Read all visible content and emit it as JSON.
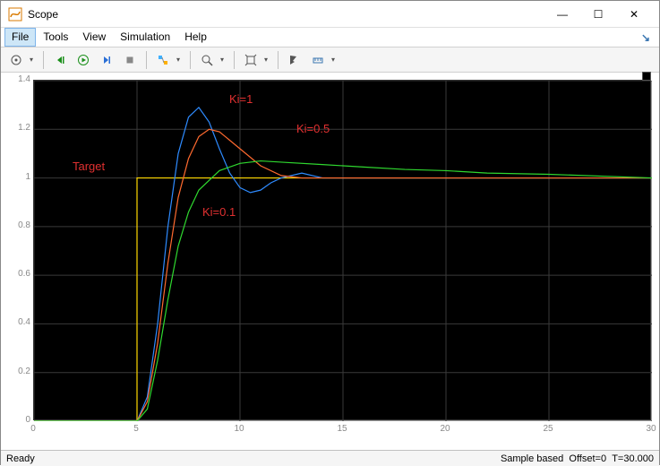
{
  "window": {
    "title": "Scope",
    "min": "—",
    "max": "☐",
    "close": "✕"
  },
  "menu": {
    "file": "File",
    "tools": "Tools",
    "view": "View",
    "simulation": "Simulation",
    "help": "Help",
    "corner": "↘"
  },
  "toolbar_icons": {
    "gear": "gear",
    "back": "step-back",
    "run": "run",
    "forward": "step-forward",
    "stop": "stop",
    "highlight": "highlight",
    "zoom": "zoom",
    "scale": "scale",
    "cursor": "cursor",
    "measure": "measure"
  },
  "annotations": {
    "target": "Target",
    "ki1": "Ki=1",
    "ki05": "Ki=0.5",
    "ki01": "Ki=0.1"
  },
  "status": {
    "ready": "Ready",
    "sample": "Sample based",
    "offset": "Offset=0",
    "time": "T=30.000"
  },
  "chart_data": {
    "type": "line",
    "xlabel": "",
    "ylabel": "",
    "xlim": [
      0,
      30
    ],
    "ylim": [
      0,
      1.4
    ],
    "x_ticks": [
      0,
      5,
      10,
      15,
      20,
      25,
      30
    ],
    "y_ticks": [
      0,
      0.2,
      0.4,
      0.6,
      0.8,
      1.0,
      1.2,
      1.4
    ],
    "series": [
      {
        "name": "Target",
        "color": "#ffd800",
        "x": [
          0,
          5,
          5,
          30
        ],
        "y": [
          0,
          0,
          1.0,
          1.0
        ]
      },
      {
        "name": "Ki=1",
        "color": "#2e8bff",
        "x": [
          0,
          5,
          5.5,
          6,
          6.5,
          7,
          7.5,
          8,
          8.5,
          9,
          9.5,
          10,
          10.5,
          11,
          11.5,
          12,
          13,
          14,
          16,
          20,
          30
        ],
        "y": [
          0,
          0,
          0.1,
          0.4,
          0.8,
          1.1,
          1.25,
          1.29,
          1.23,
          1.12,
          1.02,
          0.96,
          0.94,
          0.95,
          0.98,
          1.0,
          1.02,
          1.0,
          1.0,
          1.0,
          1.0
        ]
      },
      {
        "name": "Ki=0.5",
        "color": "#ff6a2f",
        "x": [
          0,
          5,
          5.5,
          6,
          6.5,
          7,
          7.5,
          8,
          8.5,
          9,
          10,
          11,
          12,
          13,
          14,
          16,
          20,
          30
        ],
        "y": [
          0,
          0,
          0.08,
          0.32,
          0.65,
          0.92,
          1.08,
          1.17,
          1.2,
          1.19,
          1.12,
          1.05,
          1.01,
          1.0,
          1.0,
          1.0,
          1.0,
          1.0
        ]
      },
      {
        "name": "Ki=0.1",
        "color": "#2fd82f",
        "x": [
          0,
          5,
          5.5,
          6,
          6.5,
          7,
          7.5,
          8,
          9,
          10,
          11,
          12,
          14,
          16,
          18,
          20,
          22,
          25,
          30
        ],
        "y": [
          0,
          0,
          0.05,
          0.25,
          0.5,
          0.72,
          0.86,
          0.95,
          1.03,
          1.06,
          1.07,
          1.065,
          1.055,
          1.045,
          1.035,
          1.03,
          1.02,
          1.015,
          1.0
        ]
      }
    ]
  }
}
